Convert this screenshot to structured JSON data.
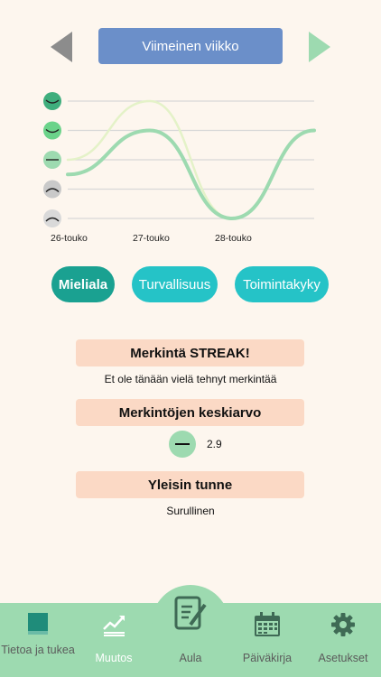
{
  "header": {
    "week_label": "Viimeinen viikko"
  },
  "chart_data": {
    "type": "line",
    "x": [
      "26-touko",
      "27-touko",
      "28-touko"
    ],
    "y_levels": [
      "very-happy-face-icon",
      "happy-face-icon",
      "neutral-face-icon",
      "sad-face-icon",
      "very-sad-face-icon"
    ],
    "series": [
      {
        "color": "#9ddab0",
        "values": [
          2.5,
          4,
          1,
          4
        ]
      },
      {
        "color": "#e4f2c8",
        "values": [
          3,
          5,
          1,
          4
        ]
      }
    ],
    "ylim": [
      1,
      5
    ]
  },
  "tabs": [
    {
      "label": "Mieliala",
      "active": true
    },
    {
      "label": "Turvallisuus",
      "active": false
    },
    {
      "label": "Toimintakyky",
      "active": false
    }
  ],
  "streak": {
    "title": "Merkintä STREAK!",
    "text": "Et ole tänään vielä tehnyt merkintää"
  },
  "average": {
    "title": "Merkintöjen keskiarvo",
    "value": "2.9"
  },
  "common": {
    "title": "Yleisin tunne",
    "text": "Surullinen"
  },
  "nav": [
    {
      "label": "Tietoa ja tukea",
      "icon": "book-icon"
    },
    {
      "label": "Muutos",
      "icon": "trend-chart-icon"
    },
    {
      "label": "Aula",
      "icon": "notes-pen-icon"
    },
    {
      "label": "Päiväkirja",
      "icon": "calendar-icon"
    },
    {
      "label": "Asetukset",
      "icon": "gear-icon"
    }
  ]
}
